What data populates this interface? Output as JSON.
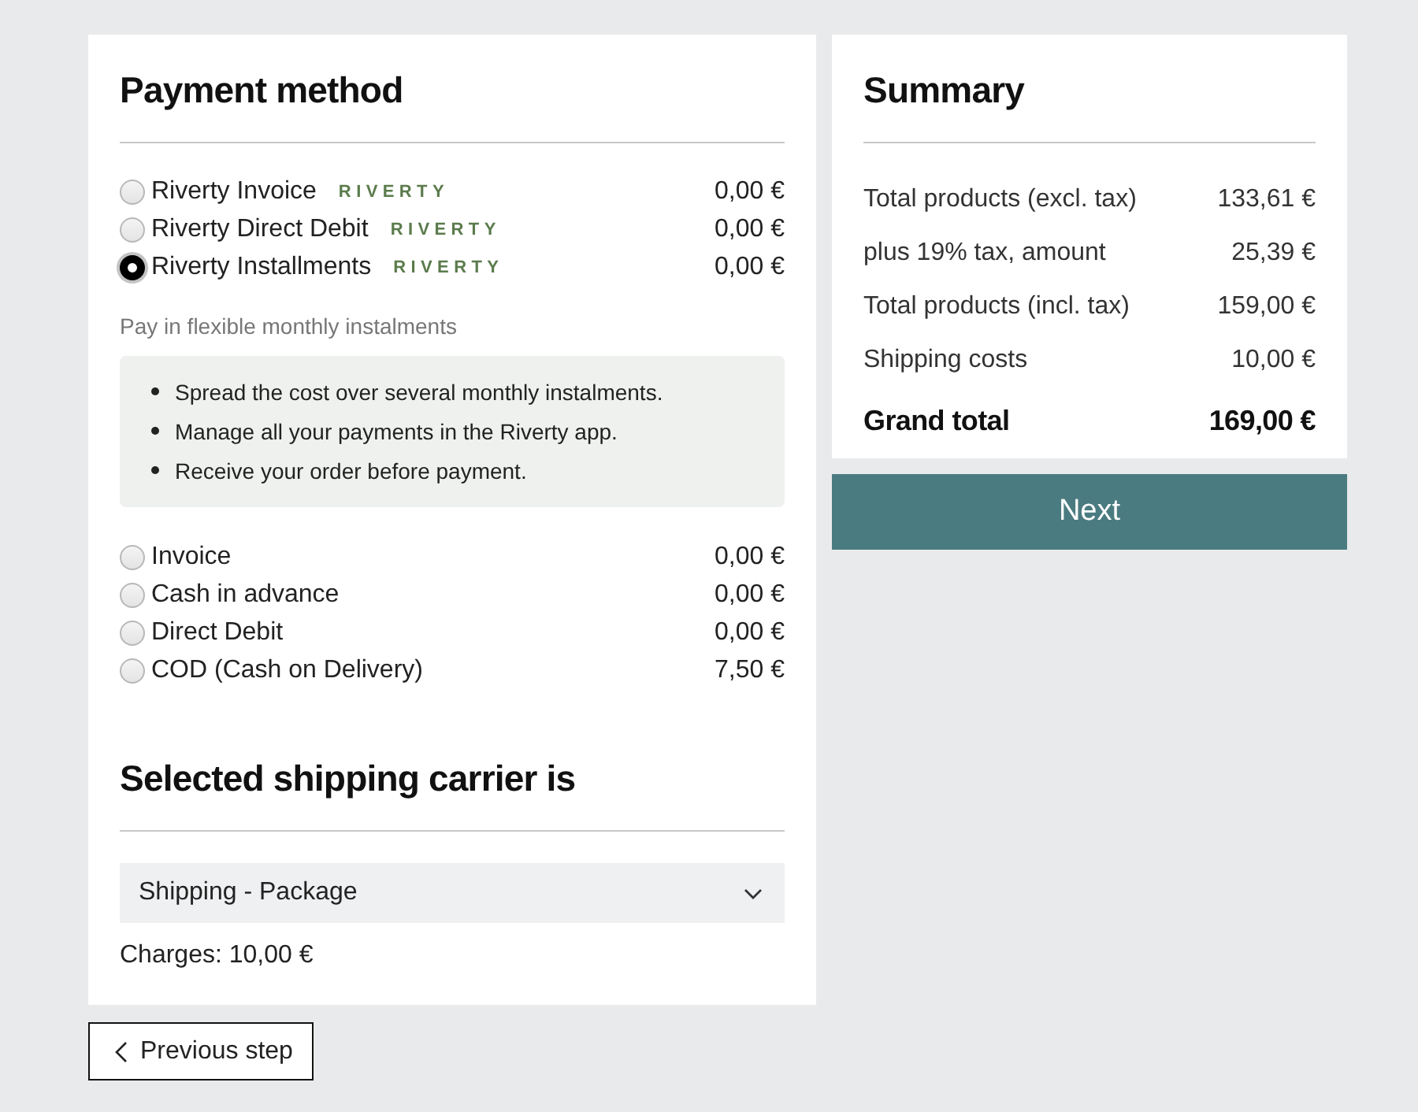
{
  "payment": {
    "title": "Payment method",
    "methods": [
      {
        "label": "Riverty Invoice",
        "logo": "RIVERTY",
        "price": "0,00 €",
        "selected": false
      },
      {
        "label": "Riverty Direct Debit",
        "logo": "RIVERTY",
        "price": "0,00 €",
        "selected": false
      },
      {
        "label": "Riverty Installments",
        "logo": "RIVERTY",
        "price": "0,00 €",
        "selected": true,
        "description": "Pay in flexible monthly instalments",
        "bullets": [
          "Spread the cost over several monthly instalments.",
          "Manage all your payments in the Riverty app.",
          "Receive your order before payment."
        ]
      },
      {
        "label": "Invoice",
        "price": "0,00 €",
        "selected": false
      },
      {
        "label": "Cash in advance",
        "price": "0,00 €",
        "selected": false
      },
      {
        "label": "Direct Debit",
        "price": "0,00 €",
        "selected": false
      },
      {
        "label": "COD (Cash on Delivery)",
        "price": "7,50 €",
        "selected": false
      }
    ]
  },
  "shipping": {
    "title": "Selected shipping carrier is",
    "carrier": "Shipping - Package",
    "charges": "Charges: 10,00 €"
  },
  "summary": {
    "title": "Summary",
    "rows": [
      {
        "label": "Total products (excl. tax)",
        "value": "133,61 €"
      },
      {
        "label": "plus 19% tax, amount",
        "value": "25,39 €"
      },
      {
        "label": "Total products (incl. tax)",
        "value": "159,00 €"
      },
      {
        "label": "Shipping costs",
        "value": "10,00 €"
      }
    ],
    "total": {
      "label": "Grand total",
      "value": "169,00 €"
    }
  },
  "buttons": {
    "next": "Next",
    "previous": "Previous step"
  }
}
